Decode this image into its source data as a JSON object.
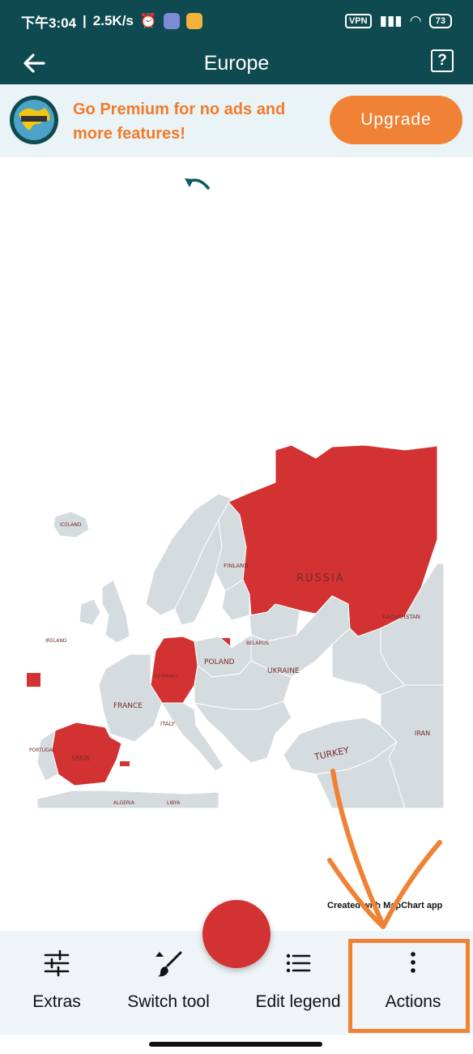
{
  "status_bar": {
    "time": "下午3:04",
    "speed": "2.5K/s",
    "vpn": "VPN",
    "battery": "73"
  },
  "app_bar": {
    "title": "Europe"
  },
  "promo": {
    "text": "Go Premium for no ads and more features!",
    "upgrade_label": "Upgrade"
  },
  "map": {
    "labels": {
      "russia": "RUSSIA",
      "kazakhstan": "KAZAKHSTAN",
      "finland": "FINLAND",
      "germany": "GERMANY",
      "poland": "POLAND",
      "ukraine": "UKRAINE",
      "france": "FRANCE",
      "italy": "ITALY",
      "spain": "SPAIN",
      "portugal": "PORTUGAL",
      "turkey": "TURKEY",
      "iran": "IRAN",
      "algeria": "ALGERIA",
      "libya": "LIBYA",
      "belarus": "BELARUS",
      "ireland": "IRELAND",
      "iceland": "ICELAND"
    },
    "colors": {
      "selected": "#d33232",
      "land": "#d5dcdf",
      "border": "#ffffff"
    }
  },
  "watermark": "Created with MapChart app",
  "toolbar": {
    "extras": "Extras",
    "switch_tool": "Switch tool",
    "edit_legend": "Edit legend",
    "actions": "Actions"
  },
  "accent_colors": {
    "app_bar": "#0e4a4f",
    "promo_text": "#f07c2a",
    "upgrade_button": "#f08236",
    "fab": "#d33232"
  }
}
